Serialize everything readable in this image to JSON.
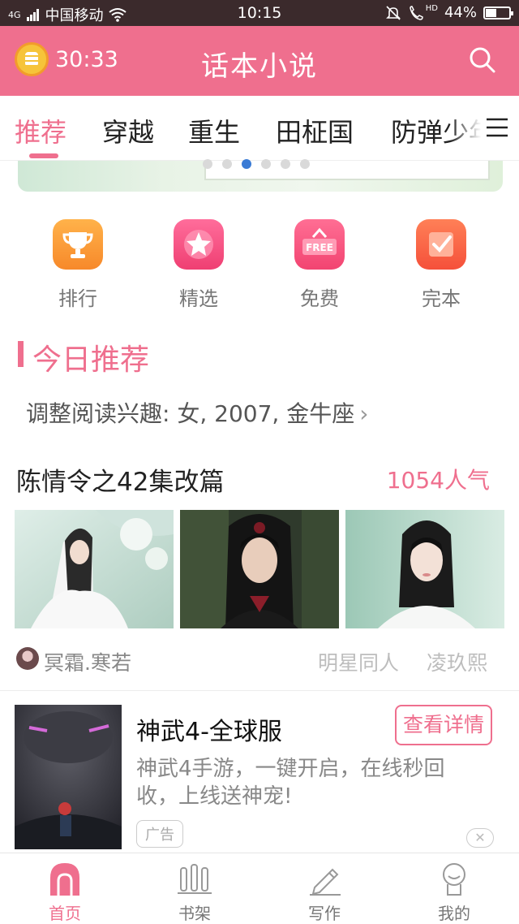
{
  "status_bar": {
    "network": "4G",
    "carrier": "中国移动",
    "time": "10:15",
    "hd": "HD",
    "battery": "44%",
    "battery_level": 0.44
  },
  "header": {
    "timer": "30:33",
    "title": "话本小说"
  },
  "tabs": [
    {
      "label": "推荐",
      "active": true
    },
    {
      "label": "穿越"
    },
    {
      "label": "重生"
    },
    {
      "label": "田柾国"
    },
    {
      "label": "防弹少年"
    }
  ],
  "categories": [
    {
      "label": "排行",
      "icon": "trophy-icon",
      "color": "#f7892a"
    },
    {
      "label": "精选",
      "icon": "star-icon",
      "color": "#ef3f72"
    },
    {
      "label": "免费",
      "icon": "free-icon",
      "color": "#f24471",
      "badge": "FREE"
    },
    {
      "label": "完本",
      "icon": "checkbox-icon",
      "color": "#f5503a"
    }
  ],
  "section": {
    "title": "今日推荐",
    "interest": "调整阅读兴趣: 女, 2007, 金牛座",
    "interest_chevron": "›"
  },
  "featured": {
    "title": "陈情令之42集改篇",
    "popularity": "1054人气",
    "author": "冥霜.寒若",
    "tags": [
      "明星同人",
      "凌玖熙"
    ]
  },
  "ad": {
    "title": "神武4-全球服",
    "button": "查看详情",
    "description": "神武4手游，一键开启，在线秒回收，上线送神宠!",
    "tag": "广告",
    "close": "✕"
  },
  "bottom_nav": [
    {
      "label": "首页",
      "icon": "home-icon",
      "active": true
    },
    {
      "label": "书架",
      "icon": "bookshelf-icon"
    },
    {
      "label": "写作",
      "icon": "pencil-icon"
    },
    {
      "label": "我的",
      "icon": "user-icon"
    }
  ],
  "colors": {
    "accent": "#ef6f8e",
    "status_bar": "#3b2a2c"
  }
}
